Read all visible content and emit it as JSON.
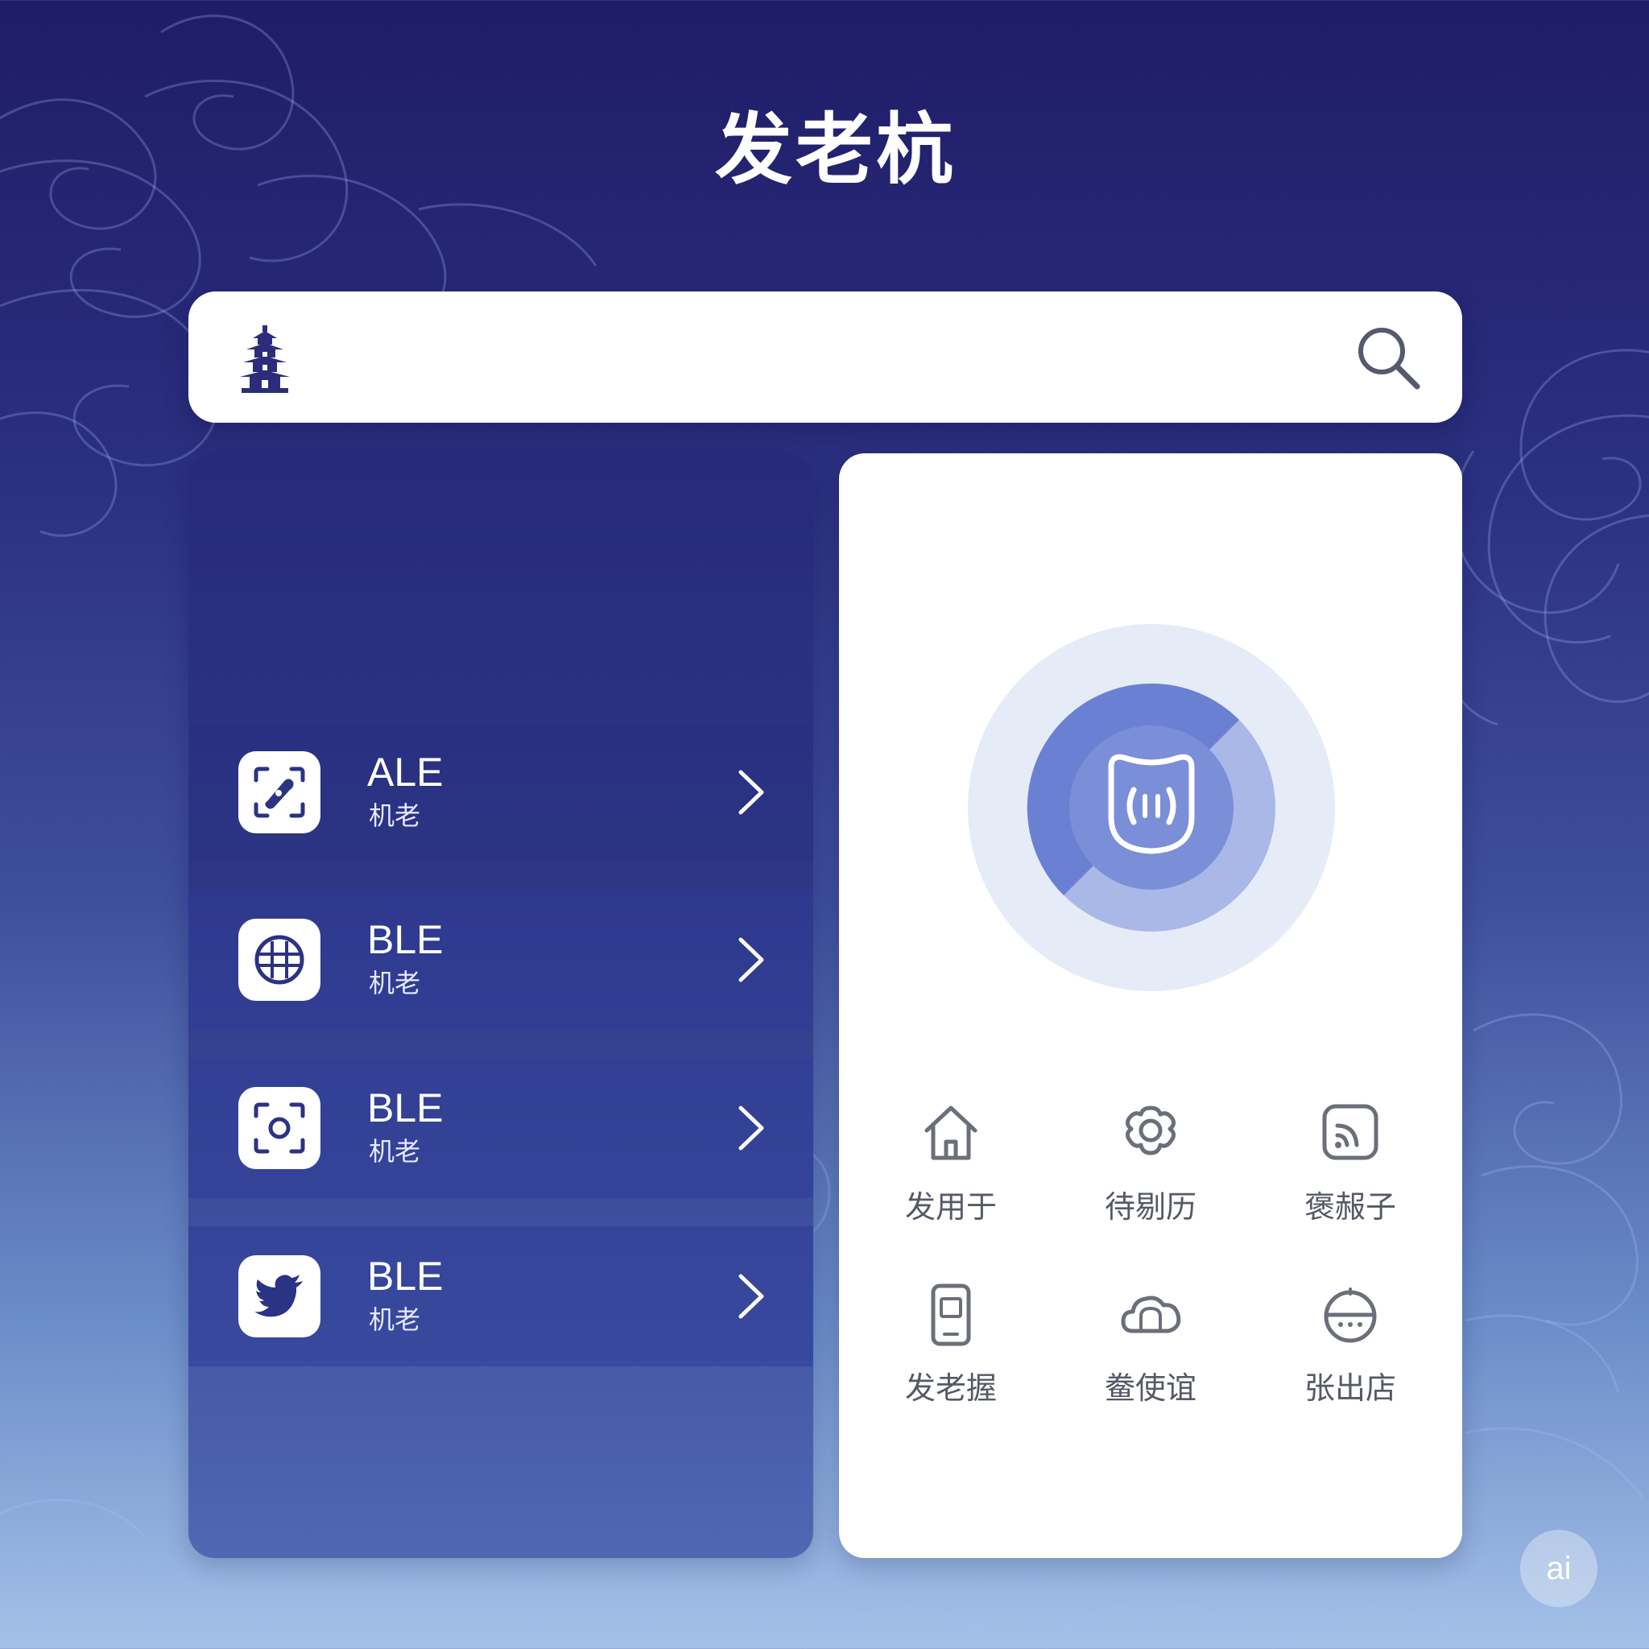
{
  "page": {
    "title": "发老杭"
  },
  "search": {
    "placeholder": "",
    "left_icon": "pagoda-icon",
    "right_icon": "search-icon"
  },
  "list": {
    "items": [
      {
        "title": "ALE",
        "subtitle": "机老",
        "icon": "scan-icon"
      },
      {
        "title": "BLE",
        "subtitle": "机老",
        "icon": "grid-globe-icon"
      },
      {
        "title": "BLE",
        "subtitle": "机老",
        "icon": "camera-focus-icon"
      },
      {
        "title": "BLE",
        "subtitle": "机老",
        "icon": "bird-icon"
      }
    ]
  },
  "hero": {
    "icon": "broadcast-icon"
  },
  "features": [
    {
      "label": "发用于",
      "icon": "home-icon"
    },
    {
      "label": "待剔历",
      "icon": "gear-icon"
    },
    {
      "label": "褒赧子",
      "icon": "rss-icon"
    },
    {
      "label": "发老握",
      "icon": "phone-icon"
    },
    {
      "label": "鲞使谊",
      "icon": "cloud-icon"
    },
    {
      "label": "张出店",
      "icon": "dome-icon"
    }
  ],
  "badge": {
    "label": "ai"
  },
  "colors": {
    "accent": "#6a80d2",
    "panel_dark": "#2b3384",
    "background_top": "#1f1c68",
    "background_bottom": "#a4c1e8"
  }
}
